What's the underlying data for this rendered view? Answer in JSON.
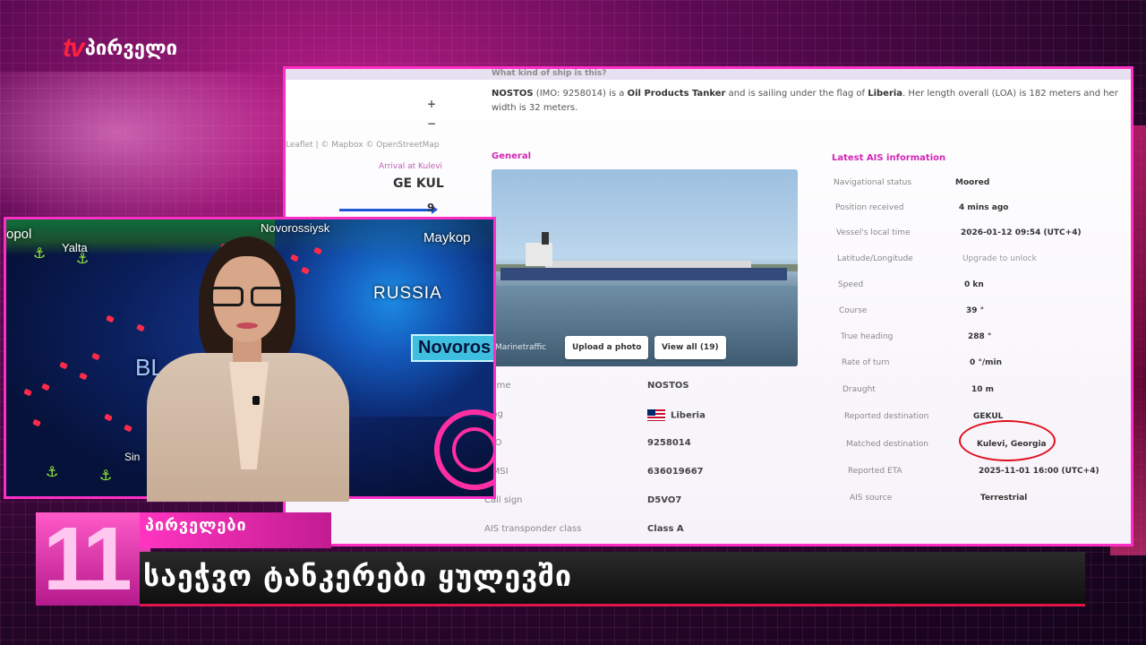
{
  "channel": {
    "logo_tv": "tv",
    "logo_name": "პირველი"
  },
  "web": {
    "question": "What kind of ship is this?",
    "desc_name": "NOSTOS",
    "desc_imo": " (IMO: 9258014) is a ",
    "desc_type": "Oil Products Tanker",
    "desc_mid": " and is sailing under the flag of ",
    "desc_flag": "Liberia",
    "desc_end": ". Her length overall (LOA) is 182 meters and her width is 32 meters.",
    "zoom_in": "+",
    "zoom_out": "−",
    "map_attribution": "Leaflet | © Mapbox © OpenStreetMap",
    "arrival_label": "Arrival at Kulevi",
    "arrival_code": "GE KUL",
    "arrival_num": "9",
    "section_general": "General",
    "section_ais": "Latest AIS information",
    "photo_credit": "Marinetraffic",
    "btn_upload": "Upload a photo",
    "btn_view_all": "View all (19)",
    "general": [
      {
        "label": "Name",
        "value": "NOSTOS"
      },
      {
        "label": "Flag",
        "value": "Liberia"
      },
      {
        "label": "IMO",
        "value": "9258014"
      },
      {
        "label": "MMSI",
        "value": "636019667"
      },
      {
        "label": "Call sign",
        "value": "D5VO7"
      },
      {
        "label": "AIS transponder class",
        "value": "Class A"
      }
    ],
    "ais": [
      {
        "label": "Navigational status",
        "value": "Moored"
      },
      {
        "label": "Position received",
        "value": "4 mins ago"
      },
      {
        "label": "Vessel's local time",
        "value": "2026-01-12 09:54 (UTC+4)"
      },
      {
        "label": "Latitude/Longitude",
        "value": "Upgrade to unlock"
      },
      {
        "label": "Speed",
        "value": "0 kn"
      },
      {
        "label": "Course",
        "value": "39 °"
      },
      {
        "label": "True heading",
        "value": "288 °"
      },
      {
        "label": "Rate of turn",
        "value": "0 °/min"
      },
      {
        "label": "Draught",
        "value": "10 m"
      },
      {
        "label": "Reported destination",
        "value": "GEKUL"
      },
      {
        "label": "Matched destination",
        "value": "Kulevi, Georgia"
      },
      {
        "label": "Reported ETA",
        "value": "2025-11-01 16:00 (UTC+4)"
      },
      {
        "label": "AIS source",
        "value": "Terrestrial"
      }
    ]
  },
  "studio_map": {
    "labels": [
      "opol",
      "Yalta",
      "Novorossiysk",
      "Maykop",
      "RUSSIA",
      "BL",
      "Sin"
    ],
    "highlight": "Novoros"
  },
  "lower_third": {
    "number": "11",
    "program": "პირველები",
    "headline": "საეჭვო ტანკერები ყულევში"
  },
  "colors": {
    "accent": "#ff2fc6",
    "red": "#e4144a"
  }
}
